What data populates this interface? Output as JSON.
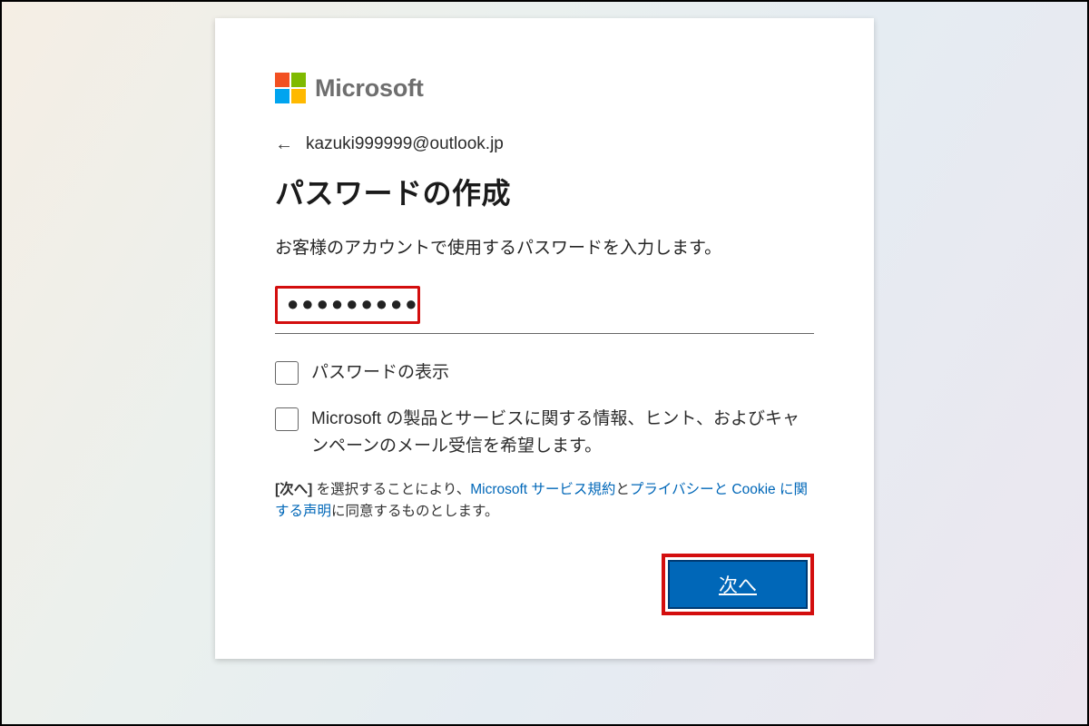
{
  "brand": {
    "name": "Microsoft"
  },
  "identity": {
    "email": "kazuki999999@outlook.jp"
  },
  "title": "パスワードの作成",
  "description": "お客様のアカウントで使用するパスワードを入力します。",
  "password": {
    "masked_value": "●●●●●●●●●"
  },
  "options": {
    "show_password": "パスワードの表示",
    "marketing_optin": "Microsoft の製品とサービスに関する情報、ヒント、およびキャンペーンのメール受信を希望します。"
  },
  "agreement": {
    "prefix_bold": "[次へ]",
    "prefix_rest": " を選択することにより、",
    "link1": "Microsoft サービス規約",
    "mid": "と",
    "link2": "プライバシーと Cookie に関する声明",
    "suffix": "に同意するものとします。"
  },
  "actions": {
    "next": "次へ"
  },
  "highlight_color": "#d30e0e",
  "primary_color": "#0067b8"
}
